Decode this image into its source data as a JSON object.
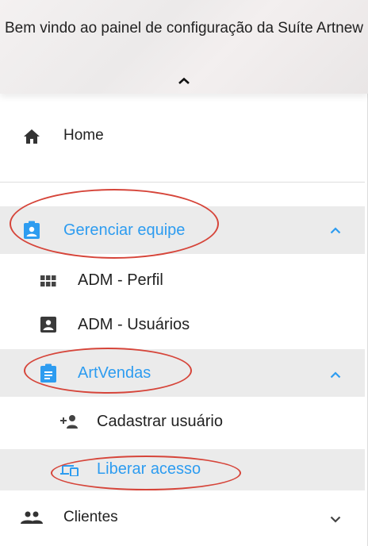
{
  "header": {
    "title": "Bem vindo ao painel de configuração da Suíte Artnew",
    "collapse_icon": "chevron-up-icon"
  },
  "nav": {
    "home": {
      "label": "Home",
      "icon": "home-icon"
    },
    "gerenciar_equipe": {
      "label": "Gerenciar equipe",
      "icon": "badge-icon",
      "expanded": true,
      "children": [
        {
          "label": "ADM - Perfil",
          "icon": "grid-icon"
        },
        {
          "label": "ADM - Usuários",
          "icon": "account-box-icon"
        }
      ]
    },
    "artvendas": {
      "label": "ArtVendas",
      "icon": "assignment-icon",
      "expanded": true,
      "children": [
        {
          "label": "Cadastrar usuário",
          "icon": "person-add-icon"
        },
        {
          "label": "Liberar acesso",
          "icon": "devices-icon",
          "selected": true
        }
      ]
    },
    "clientes": {
      "label": "Clientes",
      "icon": "people-icon",
      "expanded": false
    }
  },
  "colors": {
    "accent": "#2d9cf0",
    "selected_bg": "#ebebeb",
    "annotation": "#d6453a"
  }
}
